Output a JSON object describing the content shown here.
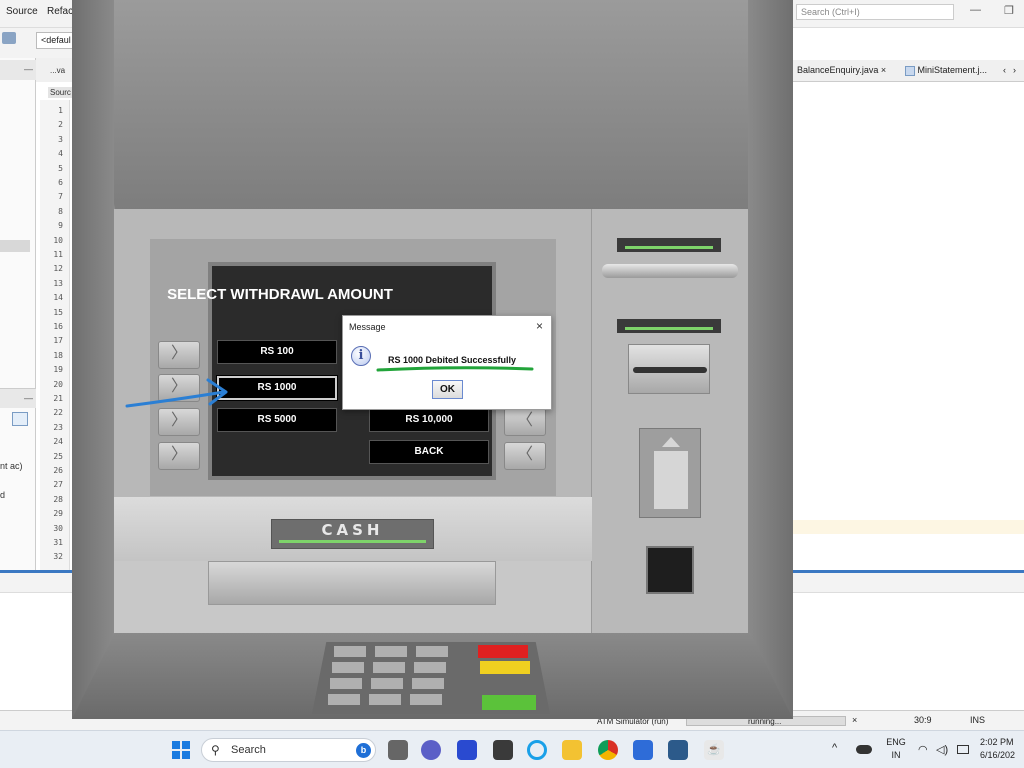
{
  "ide": {
    "menu": [
      "Source",
      "Refac"
    ],
    "search_placeholder": "Search (Ctrl+I)",
    "config_combo": "<defaul",
    "left_tab": "...va",
    "source_tab": "Sourc",
    "left_panel_texts": [
      "nt ac)",
      "d"
    ],
    "line_numbers": [
      "1",
      "2",
      "3",
      "4",
      "5",
      "6",
      "7",
      "8",
      "9",
      "10",
      "11",
      "12",
      "13",
      "14",
      "15",
      "16",
      "17",
      "18",
      "19",
      "20",
      "21",
      "22",
      "23",
      "24",
      "25",
      "26",
      "27",
      "28",
      "29",
      "30",
      "31",
      "32"
    ],
    "right_tabs": [
      "BalanceEnquiry.java",
      "MiniStatement.j..."
    ],
    "right_tab_close": "×",
    "status_run": "ATM Simulator (run)",
    "status_running": "running...",
    "status_close": "×",
    "status_position": "30:9",
    "status_mode": "INS"
  },
  "atm": {
    "screen_title": "SELECT WITHDRAWL AMOUNT",
    "amounts": {
      "rs100": "RS 100",
      "rs1000": "RS 1000",
      "rs5000": "RS 5000",
      "rs10000": "RS 10,000",
      "back": "BACK"
    },
    "side_key_left": "〉",
    "side_key_right": "〈",
    "cash_label": "CASH",
    "colors": {
      "cancel": "#e02020",
      "clear": "#f0d020",
      "enter": "#5bc23a"
    }
  },
  "dialog": {
    "title": "Message",
    "close": "×",
    "icon": "info-icon",
    "icon_glyph": "i",
    "message": "RS 1000 Debited Successfully",
    "ok": "OK"
  },
  "taskbar": {
    "search_label": "Search",
    "lang_top": "ENG",
    "lang_bottom": "IN",
    "time": "2:02 PM",
    "date": "6/16/202",
    "chevron": "^"
  }
}
